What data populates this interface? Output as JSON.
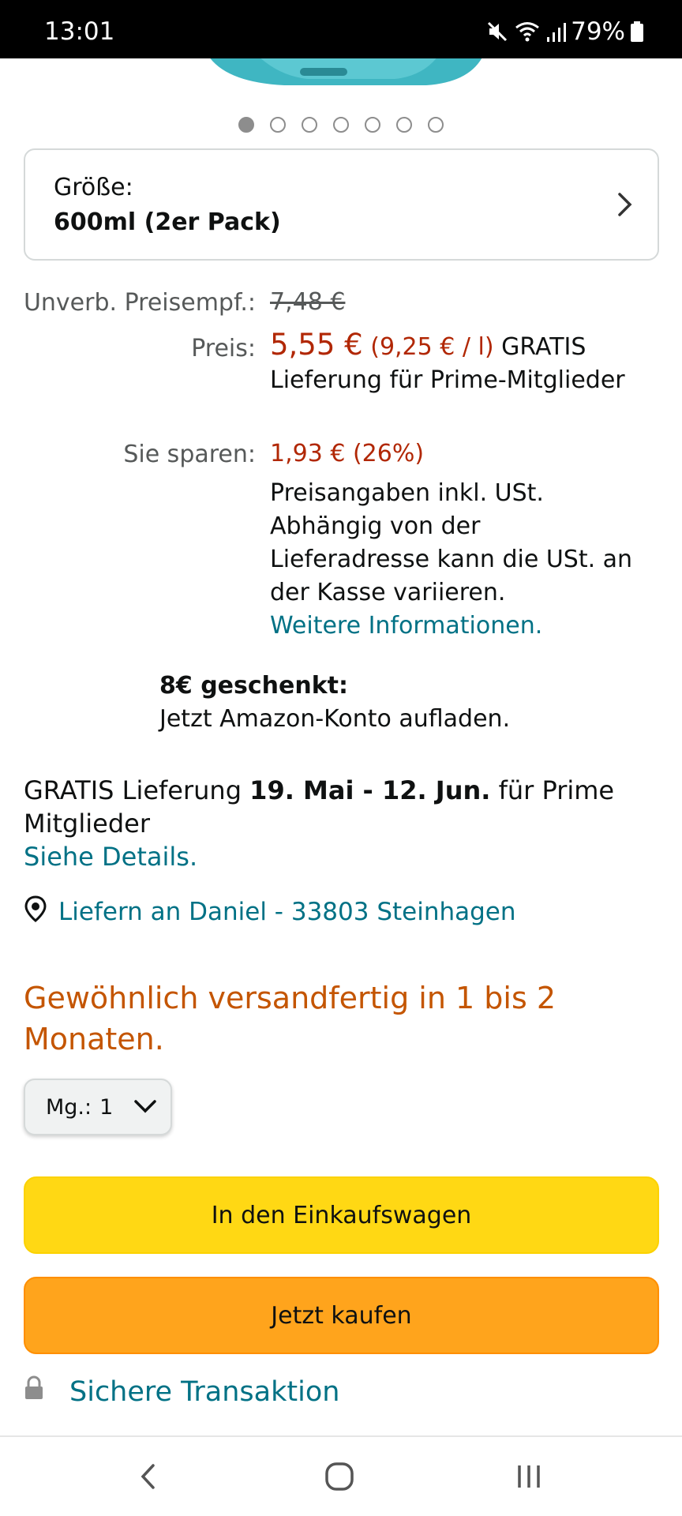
{
  "status_bar": {
    "time": "13:01",
    "battery": "79%",
    "icons": [
      "mute-icon",
      "wifi-icon",
      "signal-icon",
      "battery-icon"
    ]
  },
  "carousel": {
    "total": 7,
    "active_index": 0
  },
  "size": {
    "label": "Größe:",
    "value": "600ml (2er Pack)",
    "icon": "chevron-right-icon"
  },
  "pricing": {
    "list_label": "Unverb. Preisempf.:",
    "list_price": "7,48 €",
    "price_label": "Preis:",
    "price": "5,55 €",
    "unit_price": "(9,25 € / l)",
    "shipping_note": "GRATIS Lieferung für Prime-Mitglieder",
    "savings_label": "Sie sparen:",
    "savings": "1,93 € (26%)",
    "tax_note": "Preisangaben inkl. USt. Abhängig von der Lieferadresse kann die USt. an der Kasse variieren.",
    "more_info_link": "Weitere Informationen."
  },
  "gift": {
    "title": "8€ geschenkt:",
    "text": "Jetzt Amazon-Konto aufladen."
  },
  "delivery": {
    "prefix": "GRATIS Lieferung",
    "dates": "19. Mai - 12. Jun.",
    "suffix": "für Prime Mitglieder",
    "details_link": "Siehe Details.",
    "deliver_to": "Liefern an Daniel - 33803 Steinhagen"
  },
  "availability": "Gewöhnlich versandfertig in 1 bis 2 Monaten.",
  "quantity": {
    "label": "Mg.:",
    "value": "1"
  },
  "buttons": {
    "add_to_cart": "In den Einkaufswagen",
    "buy_now": "Jetzt kaufen"
  },
  "secure": {
    "label": "Sichere Transaktion"
  },
  "colors": {
    "price_red": "#b12704",
    "link_teal": "#007185",
    "availability_orange": "#c45500",
    "cart_yellow": "#ffd814",
    "buy_orange": "#ffa41c"
  }
}
